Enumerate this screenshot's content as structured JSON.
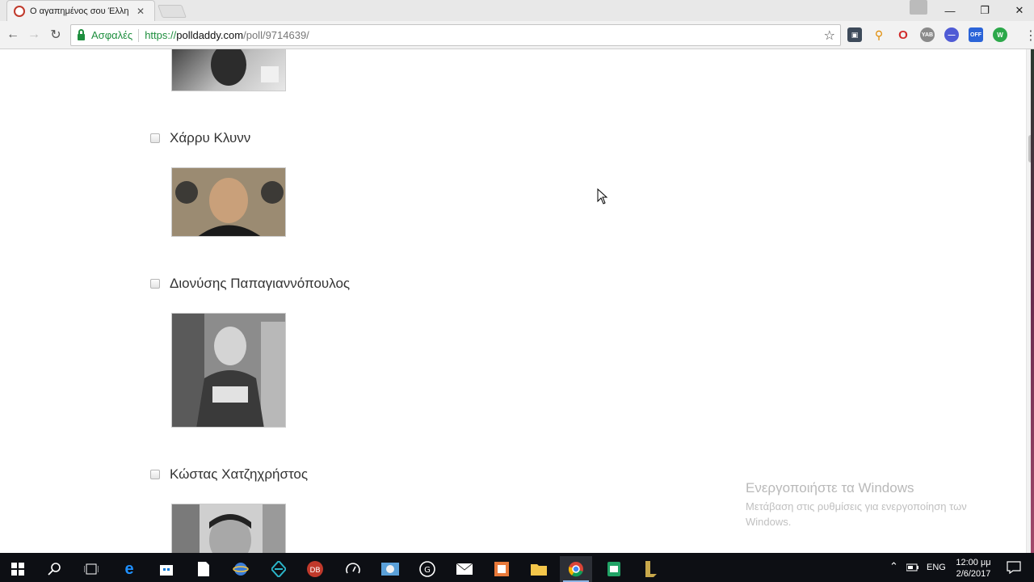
{
  "browser": {
    "tab_title": "Ο αγαπημένος σου Έλλη",
    "tab_close": "✕",
    "secure_label": "Ασφαλές",
    "url_proto": "https://",
    "url_host": "polldaddy.com",
    "url_path": "/poll/9714639/"
  },
  "poll": {
    "options": [
      {
        "label": "Χάρρυ Κλυνν"
      },
      {
        "label": "Διονύσης Παπαγιαννόπουλος"
      },
      {
        "label": "Κώστας Χατζηχρήστος"
      }
    ]
  },
  "watermark": {
    "title": "Ενεργοποιήστε τα Windows",
    "subtitle": "Μετάβαση στις ρυθμίσεις για ενεργοποίηση των Windows."
  },
  "taskbar": {
    "language": "ENG",
    "time": "12:00 μμ",
    "date": "2/6/2017"
  },
  "colors": {
    "secure_green": "#1e8e3e",
    "taskbar_bg": "#0d0f14"
  }
}
